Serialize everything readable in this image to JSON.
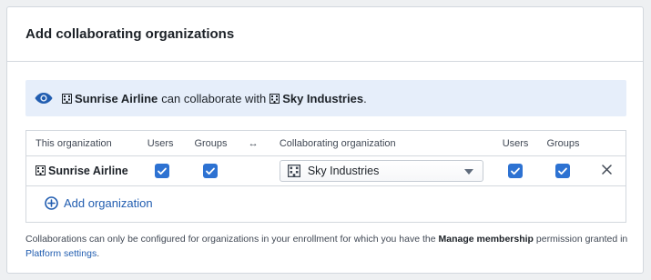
{
  "dialog": {
    "title": "Add collaborating organizations"
  },
  "callout": {
    "icon": "eye-icon",
    "org_a": "Sunrise Airline",
    "middle_text": "can collaborate with",
    "org_b": "Sky Industries",
    "end": "."
  },
  "table": {
    "headers": {
      "this_org": "This organization",
      "users": "Users",
      "groups": "Groups",
      "swap_icon": "↔",
      "collab_org": "Collaborating organization",
      "users2": "Users",
      "groups2": "Groups"
    },
    "row": {
      "this_org": "Sunrise Airline",
      "users_checked": true,
      "groups_checked": true,
      "collab_org": "Sky Industries",
      "collab_users_checked": true,
      "collab_groups_checked": true,
      "remove_icon": "×"
    },
    "add_label": "Add organization"
  },
  "footnote": {
    "part1": "Collaborations can only be configured for organizations in your enrollment for which you have the ",
    "bold": "Manage membership",
    "part2": " permission granted in ",
    "link": "Platform settings",
    "part3": "."
  },
  "colors": {
    "accent": "#2d72d2",
    "link": "#215db0",
    "callout_bg": "#e6eefa"
  }
}
